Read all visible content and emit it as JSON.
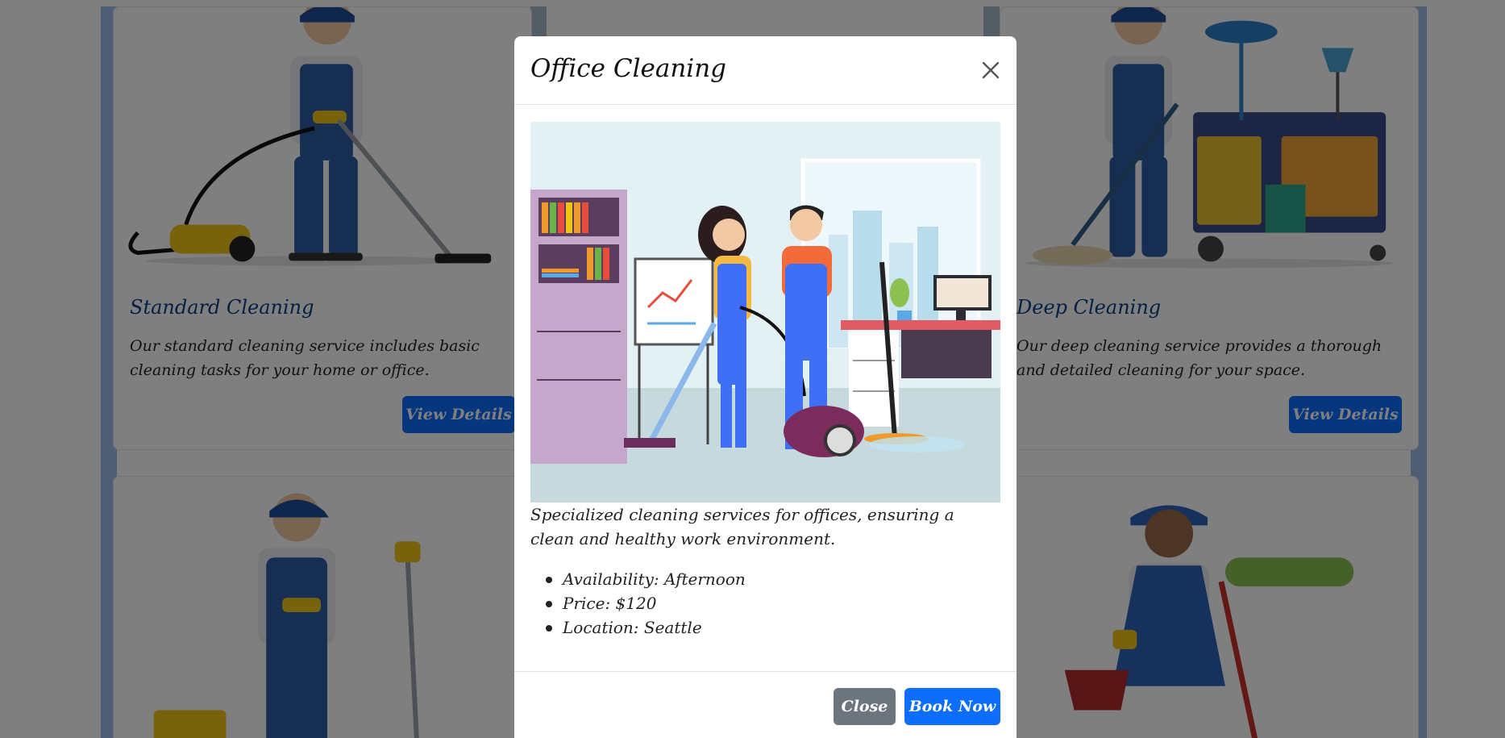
{
  "cards": [
    {
      "title": "Standard Cleaning",
      "description": "Our standard cleaning service includes basic cleaning tasks for your home or office.",
      "button": "View Details"
    },
    {
      "title": "Deep Cleaning",
      "description": "Our deep cleaning service provides a thorough and detailed cleaning for your space.",
      "button": "View Details"
    }
  ],
  "modal": {
    "title": "Office Cleaning",
    "description": "Specialized cleaning services for offices, ensuring a clean and healthy work environment.",
    "details": [
      "Availability: Afternoon",
      "Price: $120",
      "Location: Seattle"
    ],
    "close_label": "Close",
    "book_label": "Book Now",
    "close_icon": "close-icon"
  },
  "colors": {
    "primary": "#0d6efd",
    "secondary": "#6c757d",
    "card_title": "#0b3e8a"
  }
}
